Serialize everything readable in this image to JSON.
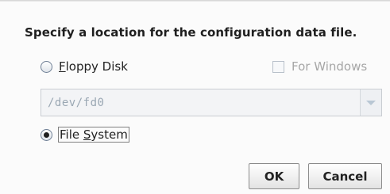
{
  "dialog": {
    "prompt": "Specify a location for the configuration data file."
  },
  "floppy": {
    "label_mnemonic": "F",
    "label_rest": "loppy Disk",
    "selected": false
  },
  "for_windows": {
    "label": "For Windows",
    "checked": false,
    "enabled": false
  },
  "device_combo": {
    "value": "/dev/fd0",
    "enabled": false,
    "arrow_icon": "chevron-down-icon"
  },
  "filesystem": {
    "label_prefix": "File ",
    "label_mnemonic": "S",
    "label_rest": "ystem",
    "selected": true
  },
  "buttons": {
    "ok_label": "OK",
    "cancel_label": "Cancel"
  }
}
